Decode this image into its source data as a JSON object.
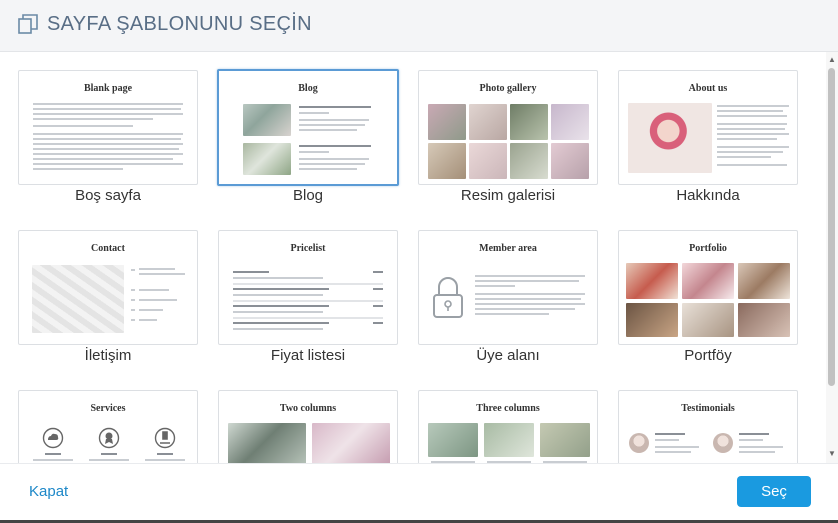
{
  "header": {
    "title": "SAYFA ŞABLONUNU SEÇİN",
    "icon": "copy-pages-icon"
  },
  "templates": [
    {
      "preview_title": "Blank page",
      "label": "Boş sayfa"
    },
    {
      "preview_title": "Blog",
      "label": "Blog",
      "selected": true
    },
    {
      "preview_title": "Photo gallery",
      "label": "Resim galerisi"
    },
    {
      "preview_title": "About us",
      "label": "Hakkında"
    },
    {
      "preview_title": "Contact",
      "label": "İletişim"
    },
    {
      "preview_title": "Pricelist",
      "label": "Fiyat listesi"
    },
    {
      "preview_title": "Member area",
      "label": "Üye alanı"
    },
    {
      "preview_title": "Portfolio",
      "label": "Portföy"
    },
    {
      "preview_title": "Services",
      "label": ""
    },
    {
      "preview_title": "Two columns",
      "label": ""
    },
    {
      "preview_title": "Three columns",
      "label": ""
    },
    {
      "preview_title": "Testimonials",
      "label": ""
    }
  ],
  "footer": {
    "close_label": "Kapat",
    "select_label": "Seç"
  },
  "colors": {
    "accent": "#1a9ae0",
    "link": "#1e88c8",
    "title": "#596e86",
    "selected_border": "#5b9bd5"
  }
}
